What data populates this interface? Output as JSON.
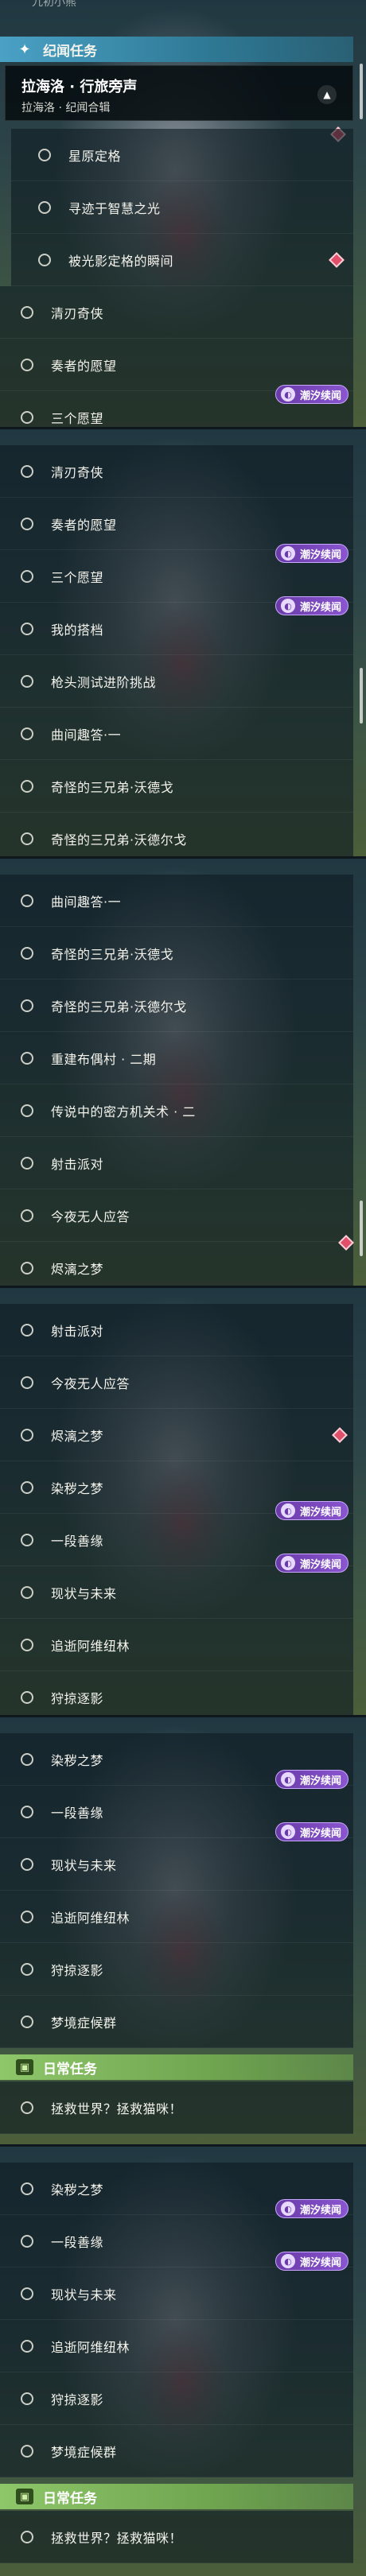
{
  "panel1": {
    "top_fragment": "九初小熊",
    "category_header": "纪闻任务",
    "active_quest": {
      "title": "拉海洛 · 行旅旁声",
      "subtitle": "拉海洛 · 纪闻合辑"
    },
    "rows": [
      "星原定格",
      "寻迹于智慧之光",
      "被光影定格的瞬间",
      "清刃奇侠",
      "奏者的愿望",
      "三个愿望"
    ],
    "badge": "潮汐续闻"
  },
  "panel2": {
    "rows": [
      "清刃奇侠",
      "奏者的愿望",
      "三个愿望",
      "我的搭档",
      "枪头测试进阶挑战",
      "曲间趣答·一",
      "奇怪的三兄弟·沃德戈",
      "奇怪的三兄弟·沃德尔戈"
    ],
    "badge": "潮汐续闻"
  },
  "panel3": {
    "rows": [
      "曲间趣答·一",
      "奇怪的三兄弟·沃德戈",
      "奇怪的三兄弟·沃德尔戈",
      "重建布偶村 · 二期",
      "传说中的密方机关术 · 二",
      "射击派对",
      "今夜无人应答",
      "烬漓之梦"
    ]
  },
  "panel4": {
    "rows": [
      "射击派对",
      "今夜无人应答",
      "烬漓之梦",
      "染秽之梦",
      "一段善缘",
      "现状与未来",
      "追逝阿维纽林",
      "狩掠逐影"
    ],
    "badge": "潮汐续闻"
  },
  "panel5": {
    "rows": [
      "染秽之梦",
      "一段善缘",
      "现状与未来",
      "追逝阿维纽林",
      "狩掠逐影",
      "梦境症候群"
    ],
    "daily_header": "日常任务",
    "daily_row": "拯救世界？拯救猫咪！",
    "badge": "潮汐续闻"
  },
  "panel6": {
    "rows": [
      "染秽之梦",
      "一段善缘",
      "现状与未来",
      "追逝阿维纽林",
      "狩掠逐影",
      "梦境症候群"
    ],
    "daily_header": "日常任务",
    "daily_row": "拯救世界？拯救猫咪！",
    "badge": "潮汐续闻"
  },
  "colors": {
    "quest_header_blue": "#4aa1c5",
    "daily_header_green": "#8ec66a",
    "badge_purple": "#7a48bc",
    "marker_red": "#e0506a"
  },
  "icons": {
    "quest_header": "sparkle-icon",
    "daily_header": "calendar-icon",
    "row": "circle-icon",
    "badge": "tide-icon",
    "marker": "diamond-marker-icon",
    "expand": "chevron-up-icon"
  }
}
